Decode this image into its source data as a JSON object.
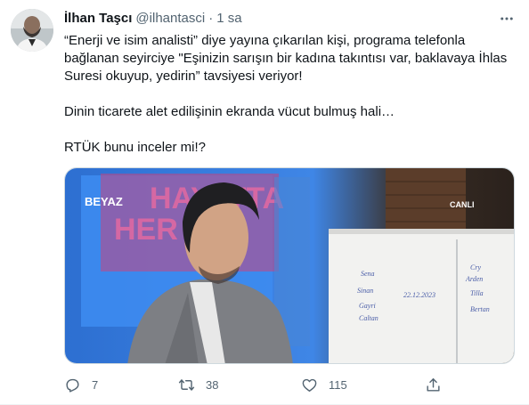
{
  "tweet": {
    "author_name": "İlhan Taşcı",
    "author_handle": "@ilhantasci",
    "separator": "·",
    "time": "1 sa",
    "paragraphs": [
      "“Enerji ve isim analisti” diye yayına çıkarılan kişi, programa telefonla bağlanan seyirciye \"Eşinizin sarışın bir kadına takıntısı var, baklavaya İhlas Suresi okuyup, yedirin” tavsiyesi veriyor!",
      "Dinin ticarete alet edilişinin ekranda vücut bulmuş hali…",
      "RTÜK bunu inceler mi!?"
    ]
  },
  "media": {
    "channel_logo": "BEYAZ",
    "live_label": "CANLI",
    "backdrop_text_1": "HAYATTA",
    "backdrop_text_2": "HER YOL",
    "board_col1": [
      "Sena",
      "Sinan",
      "Gayri",
      "Caltan"
    ],
    "board_date": "22.12.2023",
    "board_col2": [
      "Cry",
      "Arden",
      "Tilla",
      "Bertan"
    ]
  },
  "actions": {
    "reply_count": "7",
    "retweet_count": "38",
    "like_count": "115"
  },
  "icons": {
    "more": "more-horizontal-icon",
    "reply": "reply-icon",
    "retweet": "retweet-icon",
    "like": "heart-icon",
    "share": "share-icon"
  },
  "colors": {
    "text": "#0f1419",
    "muted": "#536471",
    "border": "#cfd9de"
  }
}
